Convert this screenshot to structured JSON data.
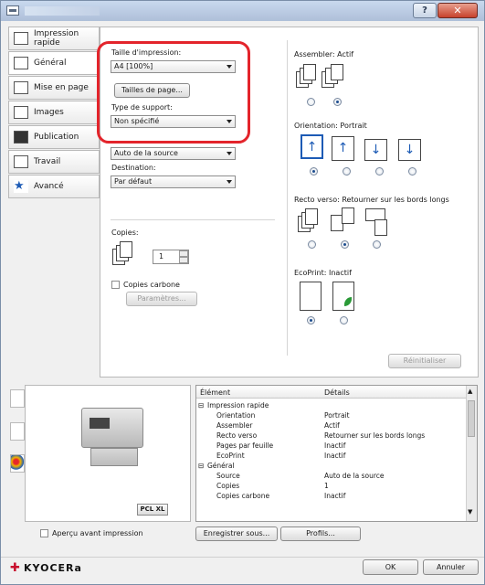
{
  "sidebar": {
    "items": [
      {
        "label": "Impression rapide"
      },
      {
        "label": "Général"
      },
      {
        "label": "Mise en page"
      },
      {
        "label": "Images"
      },
      {
        "label": "Publication"
      },
      {
        "label": "Travail"
      },
      {
        "label": "Avancé"
      }
    ]
  },
  "general": {
    "print_size_label": "Taille d'impression:",
    "print_size_value": "A4  [100%]",
    "page_sizes_button": "Tailles de page...",
    "media_type_label": "Type de support:",
    "media_type_value": "Non spécifié",
    "source_value": "Auto de la source",
    "destination_label": "Destination:",
    "destination_value": "Par défaut",
    "copies_label": "Copies:",
    "copies_value": "1",
    "carbon_copies_label": "Copies carbone",
    "settings_button": "Paramètres...",
    "collate_label": "Assembler:  Actif",
    "orientation_label": "Orientation:  Portrait",
    "duplex_label": "Recto verso:  Retourner sur les bords longs",
    "ecoprint_label": "EcoPrint:  Inactif",
    "reset_button": "Réinitialiser"
  },
  "printer": {
    "badge": "PCL XL"
  },
  "table": {
    "headers": [
      "Élément",
      "Détails"
    ],
    "rows": [
      {
        "item": "Impression rapide",
        "detail": "",
        "group": true
      },
      {
        "item": "Orientation",
        "detail": "Portrait",
        "group": false
      },
      {
        "item": "Assembler",
        "detail": "Actif",
        "group": false
      },
      {
        "item": "Recto verso",
        "detail": "Retourner sur les bords longs",
        "group": false
      },
      {
        "item": "Pages par feuille",
        "detail": "Inactif",
        "group": false
      },
      {
        "item": "EcoPrint",
        "detail": "Inactif",
        "group": false
      },
      {
        "item": "Général",
        "detail": "",
        "group": true
      },
      {
        "item": "Source",
        "detail": "Auto de la source",
        "group": false
      },
      {
        "item": "Copies",
        "detail": "1",
        "group": false
      },
      {
        "item": "Copies carbone",
        "detail": "Inactif",
        "group": false
      }
    ]
  },
  "footer": {
    "preview_checkbox": "Aperçu avant impression",
    "save_as_button": "Enregistrer sous...",
    "profiles_button": "Profils...",
    "brand": "KYOCERa",
    "ok_button": "OK",
    "cancel_button": "Annuler"
  },
  "colors": {
    "highlight": "#e3242b",
    "brand": "#c8102e",
    "accent": "#1d5bb5"
  }
}
